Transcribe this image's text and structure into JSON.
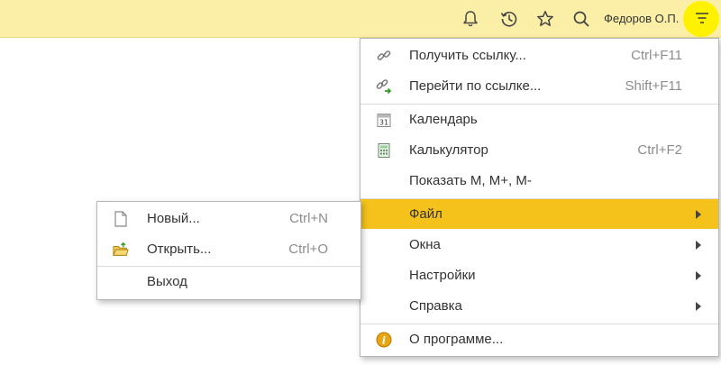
{
  "topbar": {
    "icons": [
      "bell-icon",
      "history-icon",
      "star-icon",
      "search-icon",
      "menu-icon"
    ],
    "user_name": "Федоров О.П."
  },
  "main_menu": {
    "items": [
      {
        "label": "Получить ссылку...",
        "shortcut": "Ctrl+F11",
        "icon": "link-icon"
      },
      {
        "label": "Перейти по ссылке...",
        "shortcut": "Shift+F11",
        "icon": "goto-link-icon"
      },
      {
        "label": "Календарь",
        "shortcut": "",
        "icon": "calendar-icon"
      },
      {
        "label": "Калькулятор",
        "shortcut": "Ctrl+F2",
        "icon": "calculator-icon"
      },
      {
        "label": "Показать M, M+, M-",
        "shortcut": ""
      },
      {
        "label": "Файл",
        "submenu": true,
        "active": true
      },
      {
        "label": "Окна",
        "submenu": true
      },
      {
        "label": "Настройки",
        "submenu": true
      },
      {
        "label": "Справка",
        "submenu": true
      },
      {
        "label": "О программе...",
        "icon": "info-icon"
      }
    ],
    "calendar_icon_text": "31"
  },
  "file_submenu": {
    "items": [
      {
        "label": "Новый...",
        "shortcut": "Ctrl+N",
        "icon": "new-document-icon"
      },
      {
        "label": "Открыть...",
        "shortcut": "Ctrl+O",
        "icon": "open-folder-icon"
      },
      {
        "label": "Выход"
      }
    ]
  },
  "colors": {
    "topbar": "#fbeea6",
    "highlight": "#fff200",
    "active_item": "#f5c21b"
  }
}
